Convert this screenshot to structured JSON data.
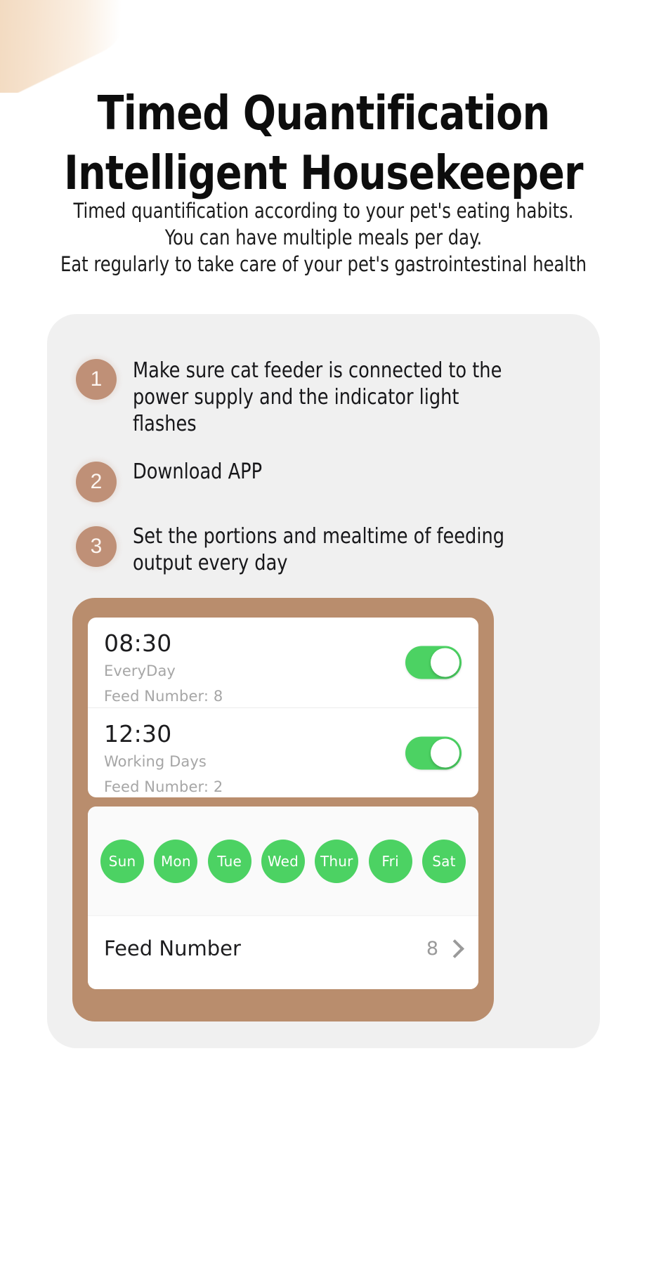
{
  "headline": {
    "line1": "Timed Quantification",
    "line2": "Intelligent Housekeeper"
  },
  "subtitle": {
    "line1": "Timed quantification according to your pet's eating habits.",
    "line2": "You can have multiple meals per day.",
    "line3": "Eat regularly to take care of your pet's gastrointestinal health"
  },
  "colors": {
    "badge_brown": "#bf9077",
    "device_brown": "#b98d6d",
    "panel_grey": "#f0f0f0",
    "accent_green": "#4cd263",
    "text_dark": "#0d0d0d",
    "text_muted": "#a6a6a6"
  },
  "steps": [
    {
      "number": "1",
      "text": "Make sure cat feeder is connected to the power supply and the indicator light flashes"
    },
    {
      "number": "2",
      "text": "Download APP"
    },
    {
      "number": "3",
      "text": "Set the portions and mealtime of feeding output every day"
    }
  ],
  "app": {
    "schedules": [
      {
        "time": "08:30",
        "repeat": "EveryDay",
        "feed": "Feed Number: 8",
        "enabled_label": "on"
      },
      {
        "time": "12:30",
        "repeat": "Working Days",
        "feed": "Feed Number: 2",
        "enabled_label": "on"
      }
    ],
    "weekdays": [
      {
        "label": "Sun",
        "selected": true
      },
      {
        "label": "Mon",
        "selected": true
      },
      {
        "label": "Tue",
        "selected": true
      },
      {
        "label": "Wed",
        "selected": true
      },
      {
        "label": "Thur",
        "selected": true
      },
      {
        "label": "Fri",
        "selected": true
      },
      {
        "label": "Sat",
        "selected": true
      }
    ],
    "feed_number_row": {
      "label": "Feed Number",
      "value": "8"
    }
  }
}
